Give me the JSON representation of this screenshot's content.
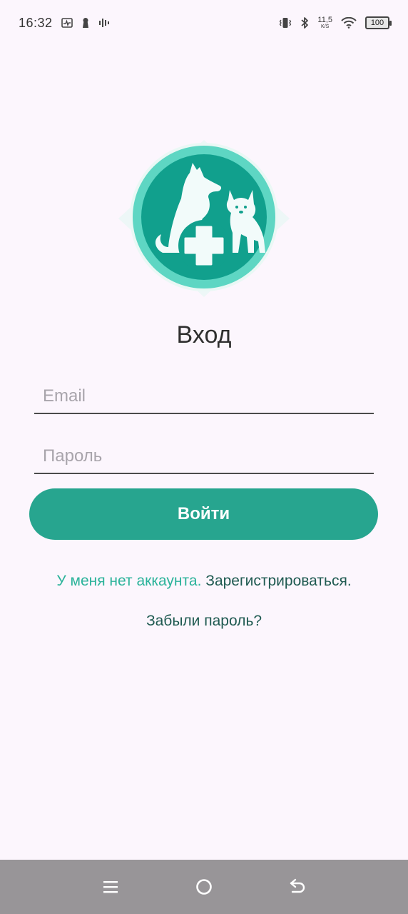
{
  "status_bar": {
    "time": "16:32",
    "net_speed_value": "11,5",
    "net_speed_unit": "K/S",
    "battery": "100",
    "icons": [
      "activity-icon",
      "keyhole-icon",
      "signal-bars-icon",
      "vibrate-icon",
      "bluetooth-icon",
      "wifi-icon",
      "battery-icon"
    ]
  },
  "logo": {
    "icon": "pet-clinic-logo-icon",
    "colors": {
      "outer": "#5ed6c3",
      "inner": "#11a08d",
      "glow": "#e6f7f4"
    }
  },
  "login": {
    "title": "Вход",
    "email_placeholder": "Email",
    "password_placeholder": "Пароль",
    "submit_label": "Войти",
    "no_account_text": "У меня нет аккаунта.",
    "register_link": "Зарегистрироваться.",
    "forgot_password": "Забыли пароль?"
  },
  "nav_bar": {
    "icons": [
      "menu-icon",
      "home-icon",
      "back-icon"
    ]
  },
  "colors": {
    "accent": "#27a58f",
    "background": "#fcf6fd",
    "link_dark": "#1f5a51",
    "link_light": "#2bb39a"
  }
}
